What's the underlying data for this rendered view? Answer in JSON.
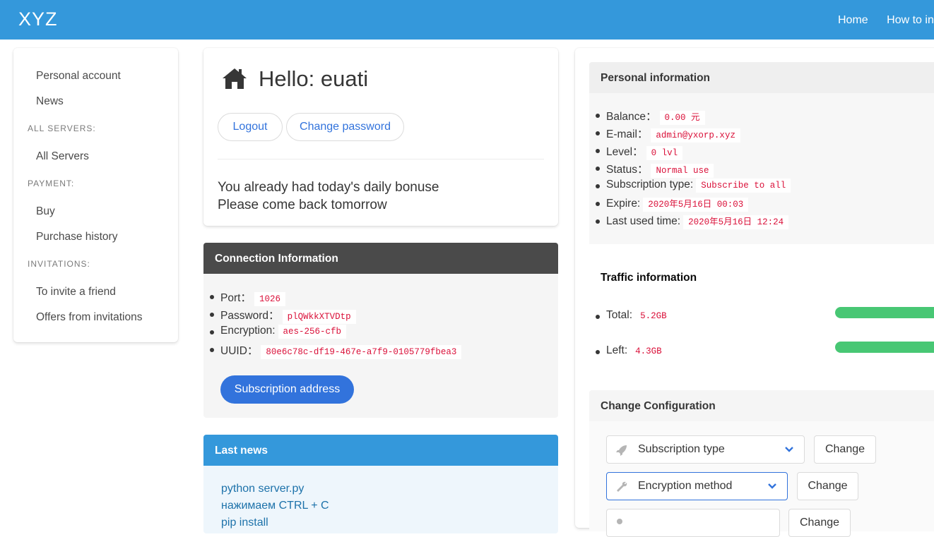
{
  "header": {
    "brand": "XYZ",
    "nav": [
      "Home",
      "How to in"
    ]
  },
  "sidebar": {
    "items": [
      {
        "type": "item",
        "label": "Personal account"
      },
      {
        "type": "item",
        "label": "News"
      },
      {
        "type": "section",
        "label": "ALL SERVERS:"
      },
      {
        "type": "item",
        "label": "All Servers"
      },
      {
        "type": "section",
        "label": "PAYMENT:"
      },
      {
        "type": "item",
        "label": "Buy"
      },
      {
        "type": "item",
        "label": "Purchase history"
      },
      {
        "type": "section",
        "label": "INVITATIONS:"
      },
      {
        "type": "item",
        "label": "To invite a friend"
      },
      {
        "type": "item",
        "label": "Offers from invitations"
      }
    ]
  },
  "hello": {
    "icon": "home-icon",
    "title": "Hello: euati",
    "logout": "Logout",
    "change_password": "Change password",
    "bonus_line1": "You already had today's daily bonuse",
    "bonus_line2": "Please come back tomorrow"
  },
  "connection": {
    "title": "Connection Information",
    "rows": [
      {
        "label": "Port：",
        "value": "1026"
      },
      {
        "label": "Password：",
        "value": "plQWkkXTVDtp"
      },
      {
        "label": "Encryption:",
        "value": "aes-256-cfb"
      },
      {
        "label": "UUID：",
        "value": "80e6c78c-df19-467e-a7f9-0105779fbea3"
      }
    ],
    "subscription_button": "Subscription address"
  },
  "news": {
    "title": "Last news",
    "lines": [
      "python server.py",
      "нажимаем CTRL + C",
      "pip install"
    ]
  },
  "personal": {
    "title": "Personal information",
    "rows": [
      {
        "label": "Balance：",
        "value": "0.00 元"
      },
      {
        "label": "E-mail：",
        "value": "admin@yxorp.xyz"
      },
      {
        "label": "Level：",
        "value": "0 lvl"
      },
      {
        "label": "Status：",
        "value": "Normal use"
      },
      {
        "label": "Subscription type:",
        "value": "Subscribe to all"
      },
      {
        "label": "Expire:",
        "value": "2020年5月16日 00:03"
      },
      {
        "label": "Last used time:",
        "value": "2020年5月16日 12:24"
      }
    ]
  },
  "traffic": {
    "title": "Traffic information",
    "total_label": "Total:",
    "total_value": "5.2GB",
    "left_label": "Left:",
    "left_value": "4.3GB",
    "bar_color": "#48c774"
  },
  "config": {
    "title": "Change Configuration",
    "rows": [
      {
        "icon": "rocket-icon",
        "select": "Subscription type",
        "button": "Change"
      },
      {
        "icon": "wrench-icon",
        "select": "Encryption method",
        "button": "Change"
      },
      {
        "icon": "key-icon",
        "select": "",
        "button": "Change"
      }
    ]
  },
  "colors": {
    "topbar": "#3498db",
    "primary": "#3273dc",
    "dark_panel": "#4a4a4a",
    "code": "#da1039",
    "success": "#48c774"
  }
}
